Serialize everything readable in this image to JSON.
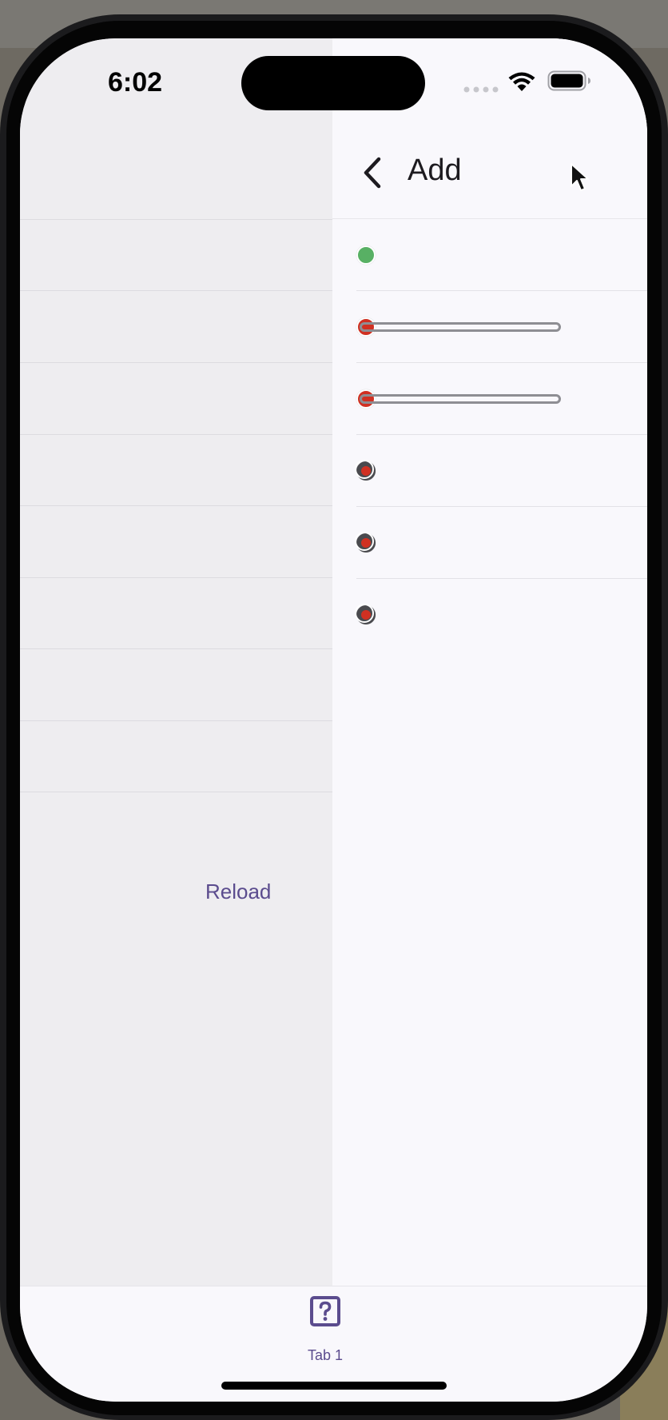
{
  "status_bar": {
    "time": "6:02",
    "icons": [
      "cellular-dots-icon",
      "wifi-icon",
      "battery-icon"
    ]
  },
  "background_page": {
    "reload_label": "Reload",
    "row_count": 8
  },
  "app_bar": {
    "title": "Add",
    "back_icon": "chevron-left-icon"
  },
  "list": {
    "rows": [
      {
        "indicator": "green-dot",
        "has_bar": false
      },
      {
        "indicator": "red-dot",
        "has_bar": true
      },
      {
        "indicator": "red-dot",
        "has_bar": true
      },
      {
        "indicator": "dark-red-dot",
        "has_bar": false
      },
      {
        "indicator": "dark-red-dot",
        "has_bar": false
      },
      {
        "indicator": "dark-red-dot",
        "has_bar": false
      }
    ]
  },
  "tab_bar": {
    "tabs": [
      {
        "label": "Tab 1",
        "icon": "question-box-icon",
        "selected": true
      }
    ]
  },
  "colors": {
    "accent": "#5b4c8e",
    "green": "#58b064",
    "red": "#d03022",
    "background": "#f9f8fc",
    "background_page": "#eeedf0"
  }
}
